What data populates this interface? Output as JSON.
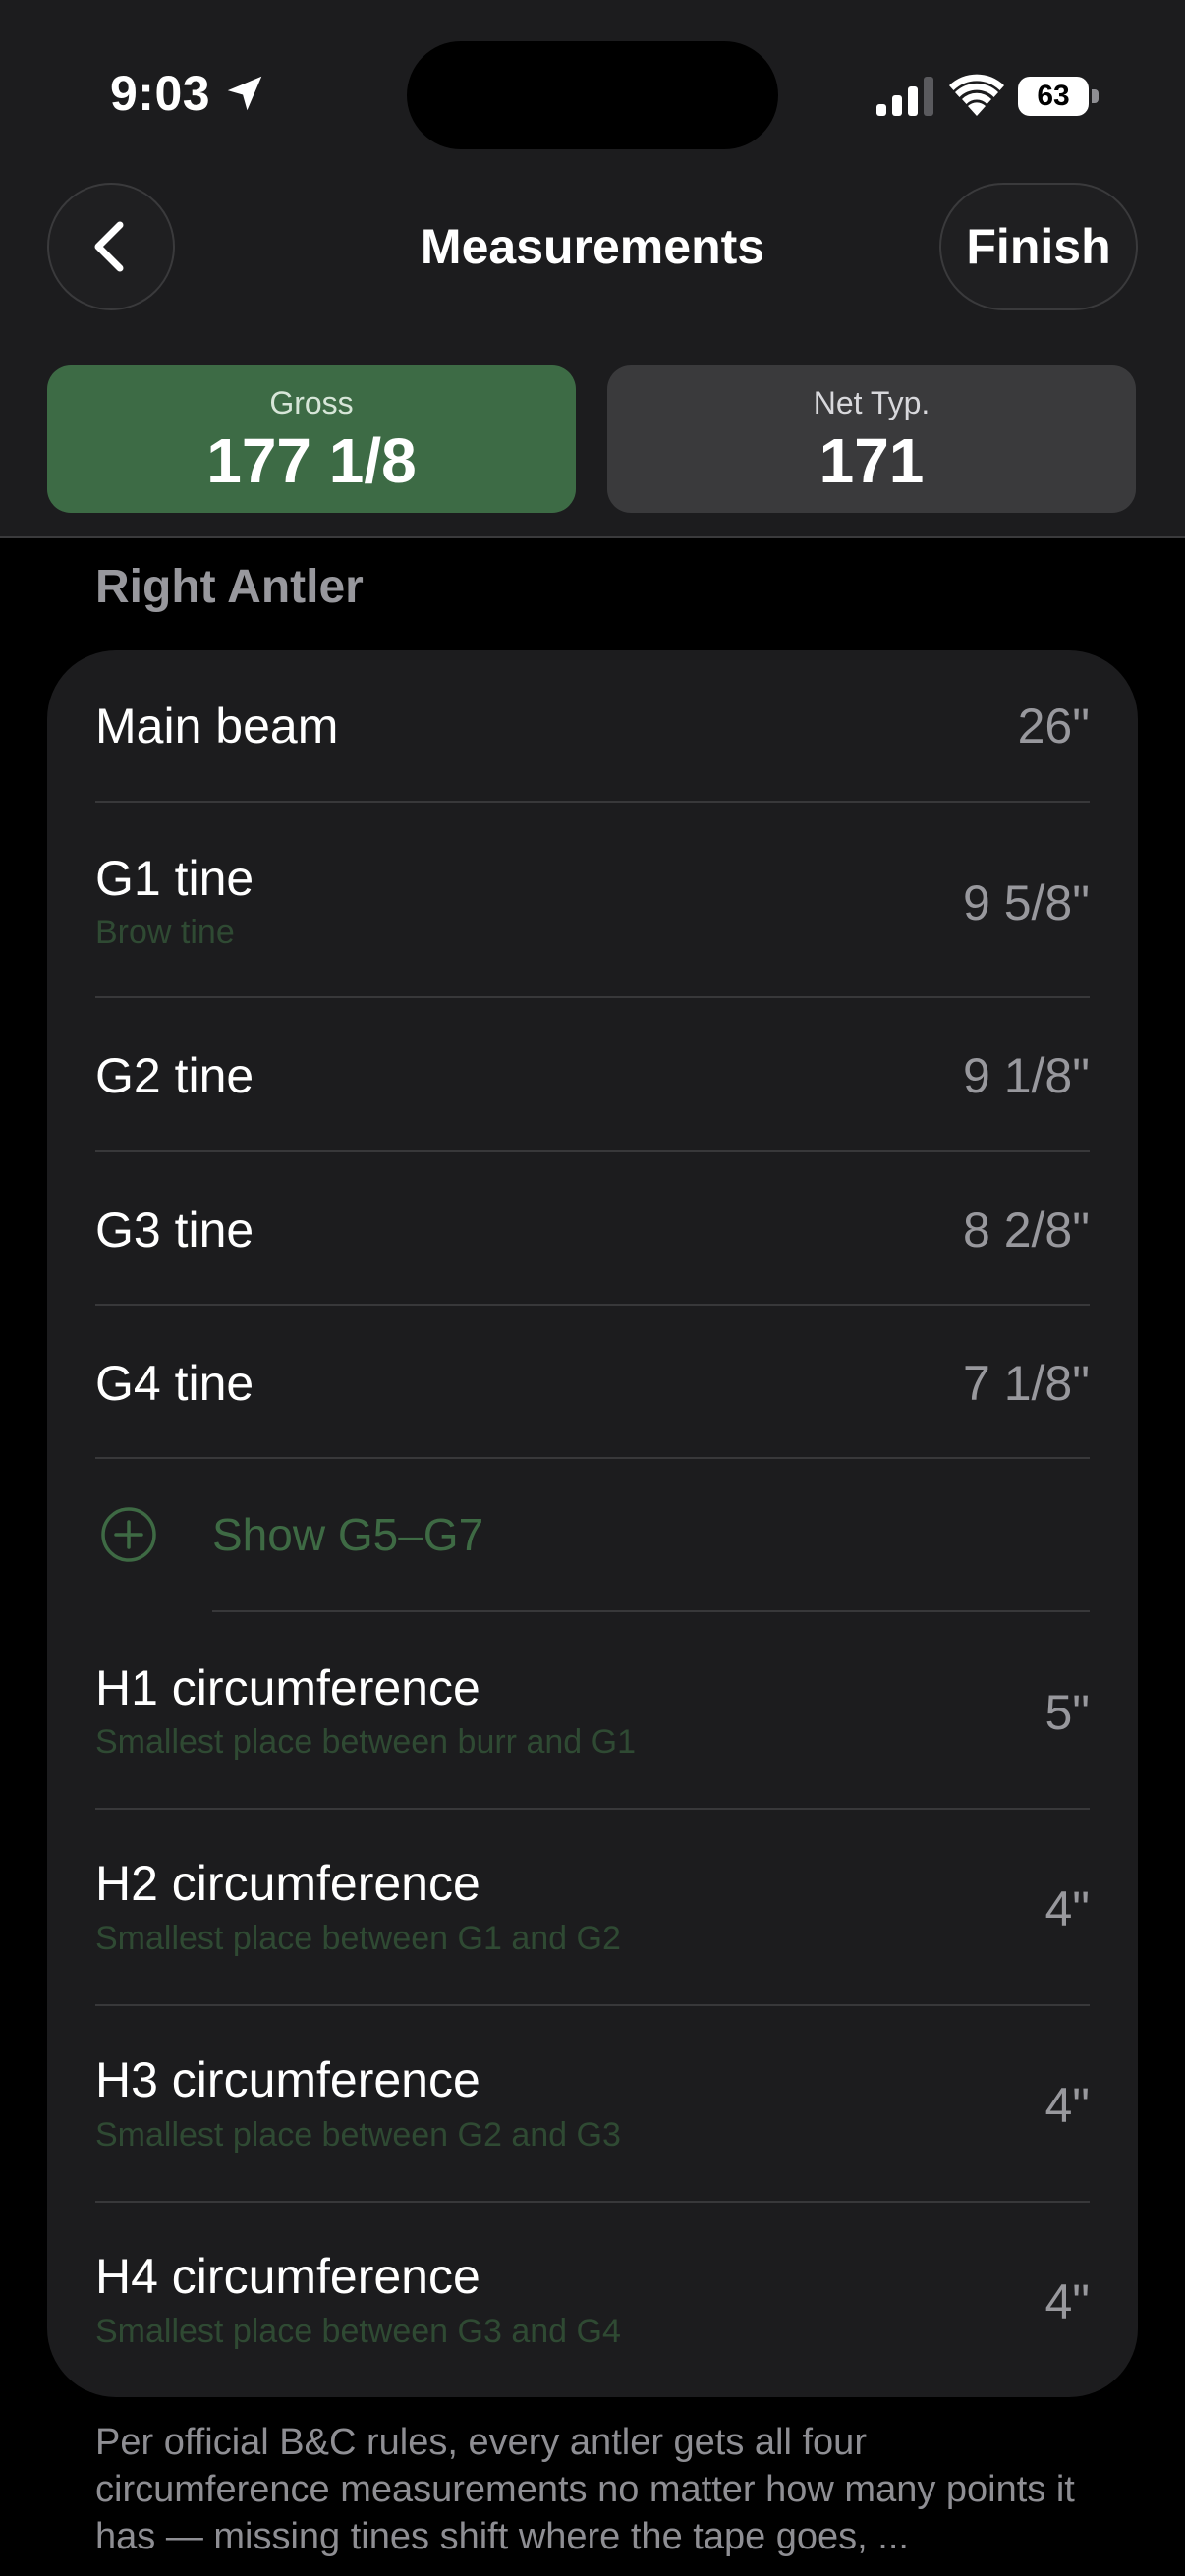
{
  "status_bar": {
    "time": "9:03",
    "battery": "63",
    "icons": [
      "location-arrow-icon",
      "cellular-signal-icon",
      "wifi-icon",
      "battery-icon"
    ]
  },
  "nav": {
    "title": "Measurements",
    "back_icon": "chevron-left-icon",
    "finish_label": "Finish"
  },
  "scores": {
    "gross": {
      "label": "Gross",
      "value": "177 1/8",
      "color": "#3d6b45"
    },
    "net": {
      "label": "Net Typ.",
      "value": "171",
      "color": "#3a3a3c"
    }
  },
  "section": {
    "title": "Right Antler",
    "rows": [
      {
        "title": "Main beam",
        "subtitle": "",
        "value": "26\""
      },
      {
        "title": "G1 tine",
        "subtitle": "Brow tine",
        "value": "9 5/8\""
      },
      {
        "title": "G2 tine",
        "subtitle": "",
        "value": "9 1/8\""
      },
      {
        "title": "G3 tine",
        "subtitle": "",
        "value": "8 2/8\""
      },
      {
        "title": "G4 tine",
        "subtitle": "",
        "value": "7 1/8\""
      }
    ],
    "show_more": {
      "label": "Show G5–G7",
      "icon": "plus-circle-icon"
    },
    "circumference_rows": [
      {
        "title": "H1 circumference",
        "subtitle": "Smallest place between burr and G1",
        "value": "5\""
      },
      {
        "title": "H2 circumference",
        "subtitle": "Smallest place between G1 and G2",
        "value": "4\""
      },
      {
        "title": "H3 circumference",
        "subtitle": "Smallest place between G2 and G3",
        "value": "4\""
      },
      {
        "title": "H4 circumference",
        "subtitle": "Smallest place between G3 and G4",
        "value": "4\""
      }
    ]
  },
  "footer_note": "Per official B&C rules, every antler gets all four circumference measurements no matter how many points it has — missing tines shift where the tape goes, ...",
  "colors": {
    "accent_green": "#3d6b45",
    "muted_green_text": "#3e6a44",
    "background": "#000000",
    "card": "#1c1c1e"
  }
}
